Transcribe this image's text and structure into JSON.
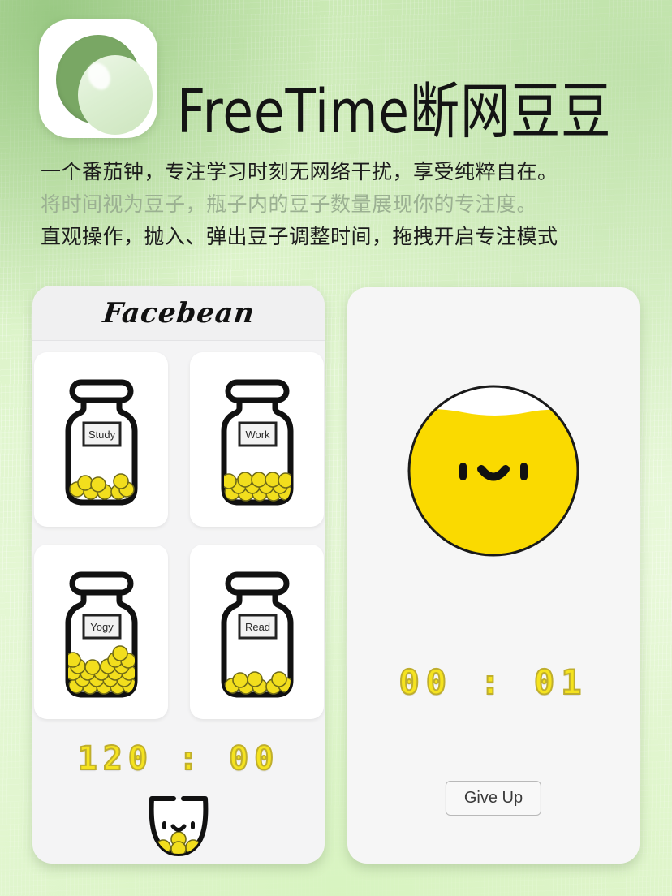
{
  "header": {
    "app_icon_name": "bean-bubble-icon",
    "title": "FreeTime断网豆豆",
    "subtitles": [
      {
        "text": "一个番茄钟，专注学习时刻无网络干扰，享受纯粹自在。",
        "style": "dark"
      },
      {
        "text": "将时间视为豆子，瓶子内的豆子数量展现你的专注度。",
        "style": "muted"
      },
      {
        "text": "直观操作，抛入、弹出豆子调整时间，拖拽开启专注模式",
        "style": "dark"
      }
    ]
  },
  "left_panel": {
    "title": "Facebean",
    "jars": [
      {
        "label": "Study",
        "bean_count": 8
      },
      {
        "label": "Work",
        "bean_count": 14
      },
      {
        "label": "Yogy",
        "bean_count": 22
      },
      {
        "label": "Read",
        "bean_count": 8
      }
    ],
    "timer": "120 : 00",
    "cup_icon_name": "bean-cup-face-icon",
    "cup_bean_count": 4
  },
  "right_panel": {
    "bean_face_icon_name": "bean-face-fill-icon",
    "fill_percent": 90,
    "timer": "00 : 01",
    "give_up_label": "Give Up"
  },
  "colors": {
    "background_green": "#ddf3c9",
    "panel_surface": "#f4f4f5",
    "card_surface": "#ffffff",
    "bean_yellow": "#f2de1d",
    "bean_outline": "#6f6a18",
    "timer_yellow": "#f5e31f",
    "timer_stroke": "#bfae2d",
    "ink_black": "#141414",
    "muted_green": "#9bb092"
  }
}
